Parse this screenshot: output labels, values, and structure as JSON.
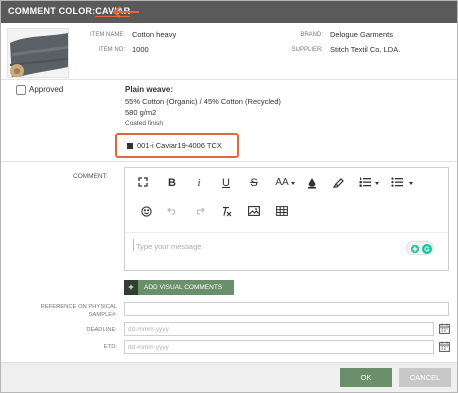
{
  "dialog": {
    "title_prefix": "COMMENT COLOR:",
    "title_color": "CAVIAR"
  },
  "item": {
    "item_name_label": "ITEM NAME:",
    "item_name": "Cotton heavy",
    "item_no_label": "ITEM NO:",
    "item_no": "1000",
    "brand_label": "BRAND:",
    "brand": "Delogue Garments",
    "supplier_label": "SUPPLIER:",
    "supplier": "Stitch Textil Co. LDA."
  },
  "approved_label": "Approved",
  "weave": {
    "title": "Plain weave:",
    "composition": "55% Cotton (Organic) / 45% Cotton (Recycled)",
    "weight": "580 g/m2",
    "finish": "Coated finish"
  },
  "color": {
    "code": "001-i Caviar19-4006 TCX",
    "swatch": "#333333"
  },
  "comment": {
    "label": "COMMENT:",
    "placeholder": "Type your message",
    "toolbar_icons": [
      "fullscreen-icon",
      "bold-icon",
      "italic-icon",
      "underline-icon",
      "strikethrough-icon",
      "font-size-icon",
      "text-color-icon",
      "highlight-icon",
      "ordered-list-icon",
      "unordered-list-icon",
      "emoji-icon",
      "undo-icon",
      "redo-icon",
      "clear-format-icon",
      "image-icon",
      "table-icon"
    ],
    "font_size_label": "AA"
  },
  "add_visual_label": "ADD VISUAL COMMENTS",
  "fields": {
    "reference_label": "REFERENCE ON PHYSICAL SAMPLE#:",
    "deadline_label": "DEADLINE:",
    "deadline_placeholder": "dd-mmm-yyyy",
    "etd_label": "ETD:",
    "etd_placeholder": "dd-mmm-yyyy"
  },
  "buttons": {
    "ok": "OK",
    "cancel": "CANCEL"
  },
  "colors": {
    "accent": "#e0683f",
    "primary": "#6b8f6b",
    "titlebar": "#5a5a5a"
  }
}
